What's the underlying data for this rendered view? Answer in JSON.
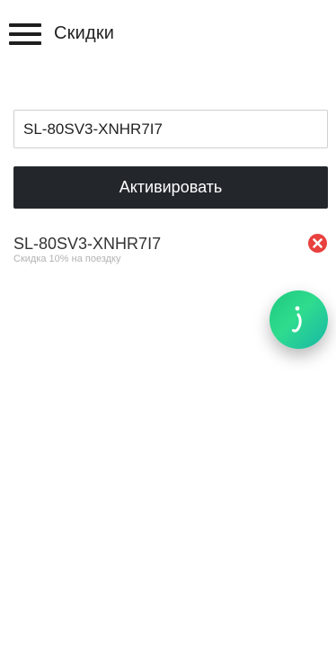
{
  "header": {
    "title": "Скидки",
    "menu_icon": "hamburger-menu-icon"
  },
  "promo_form": {
    "input_value": "SL-80SV3-XNHR7I7",
    "activate_label": "Активировать"
  },
  "promo_list": [
    {
      "code": "SL-80SV3-XNHR7I7",
      "description": "Скидка 10% на поездку",
      "remove_icon": "close-circle-icon"
    }
  ],
  "chat_widget": {
    "icon": "chat-widget-icon"
  },
  "colors": {
    "button_bg": "#23272b",
    "remove_red": "#e8413e",
    "chat_green": "#2fdc8e",
    "muted_text": "#b2b2b2"
  }
}
